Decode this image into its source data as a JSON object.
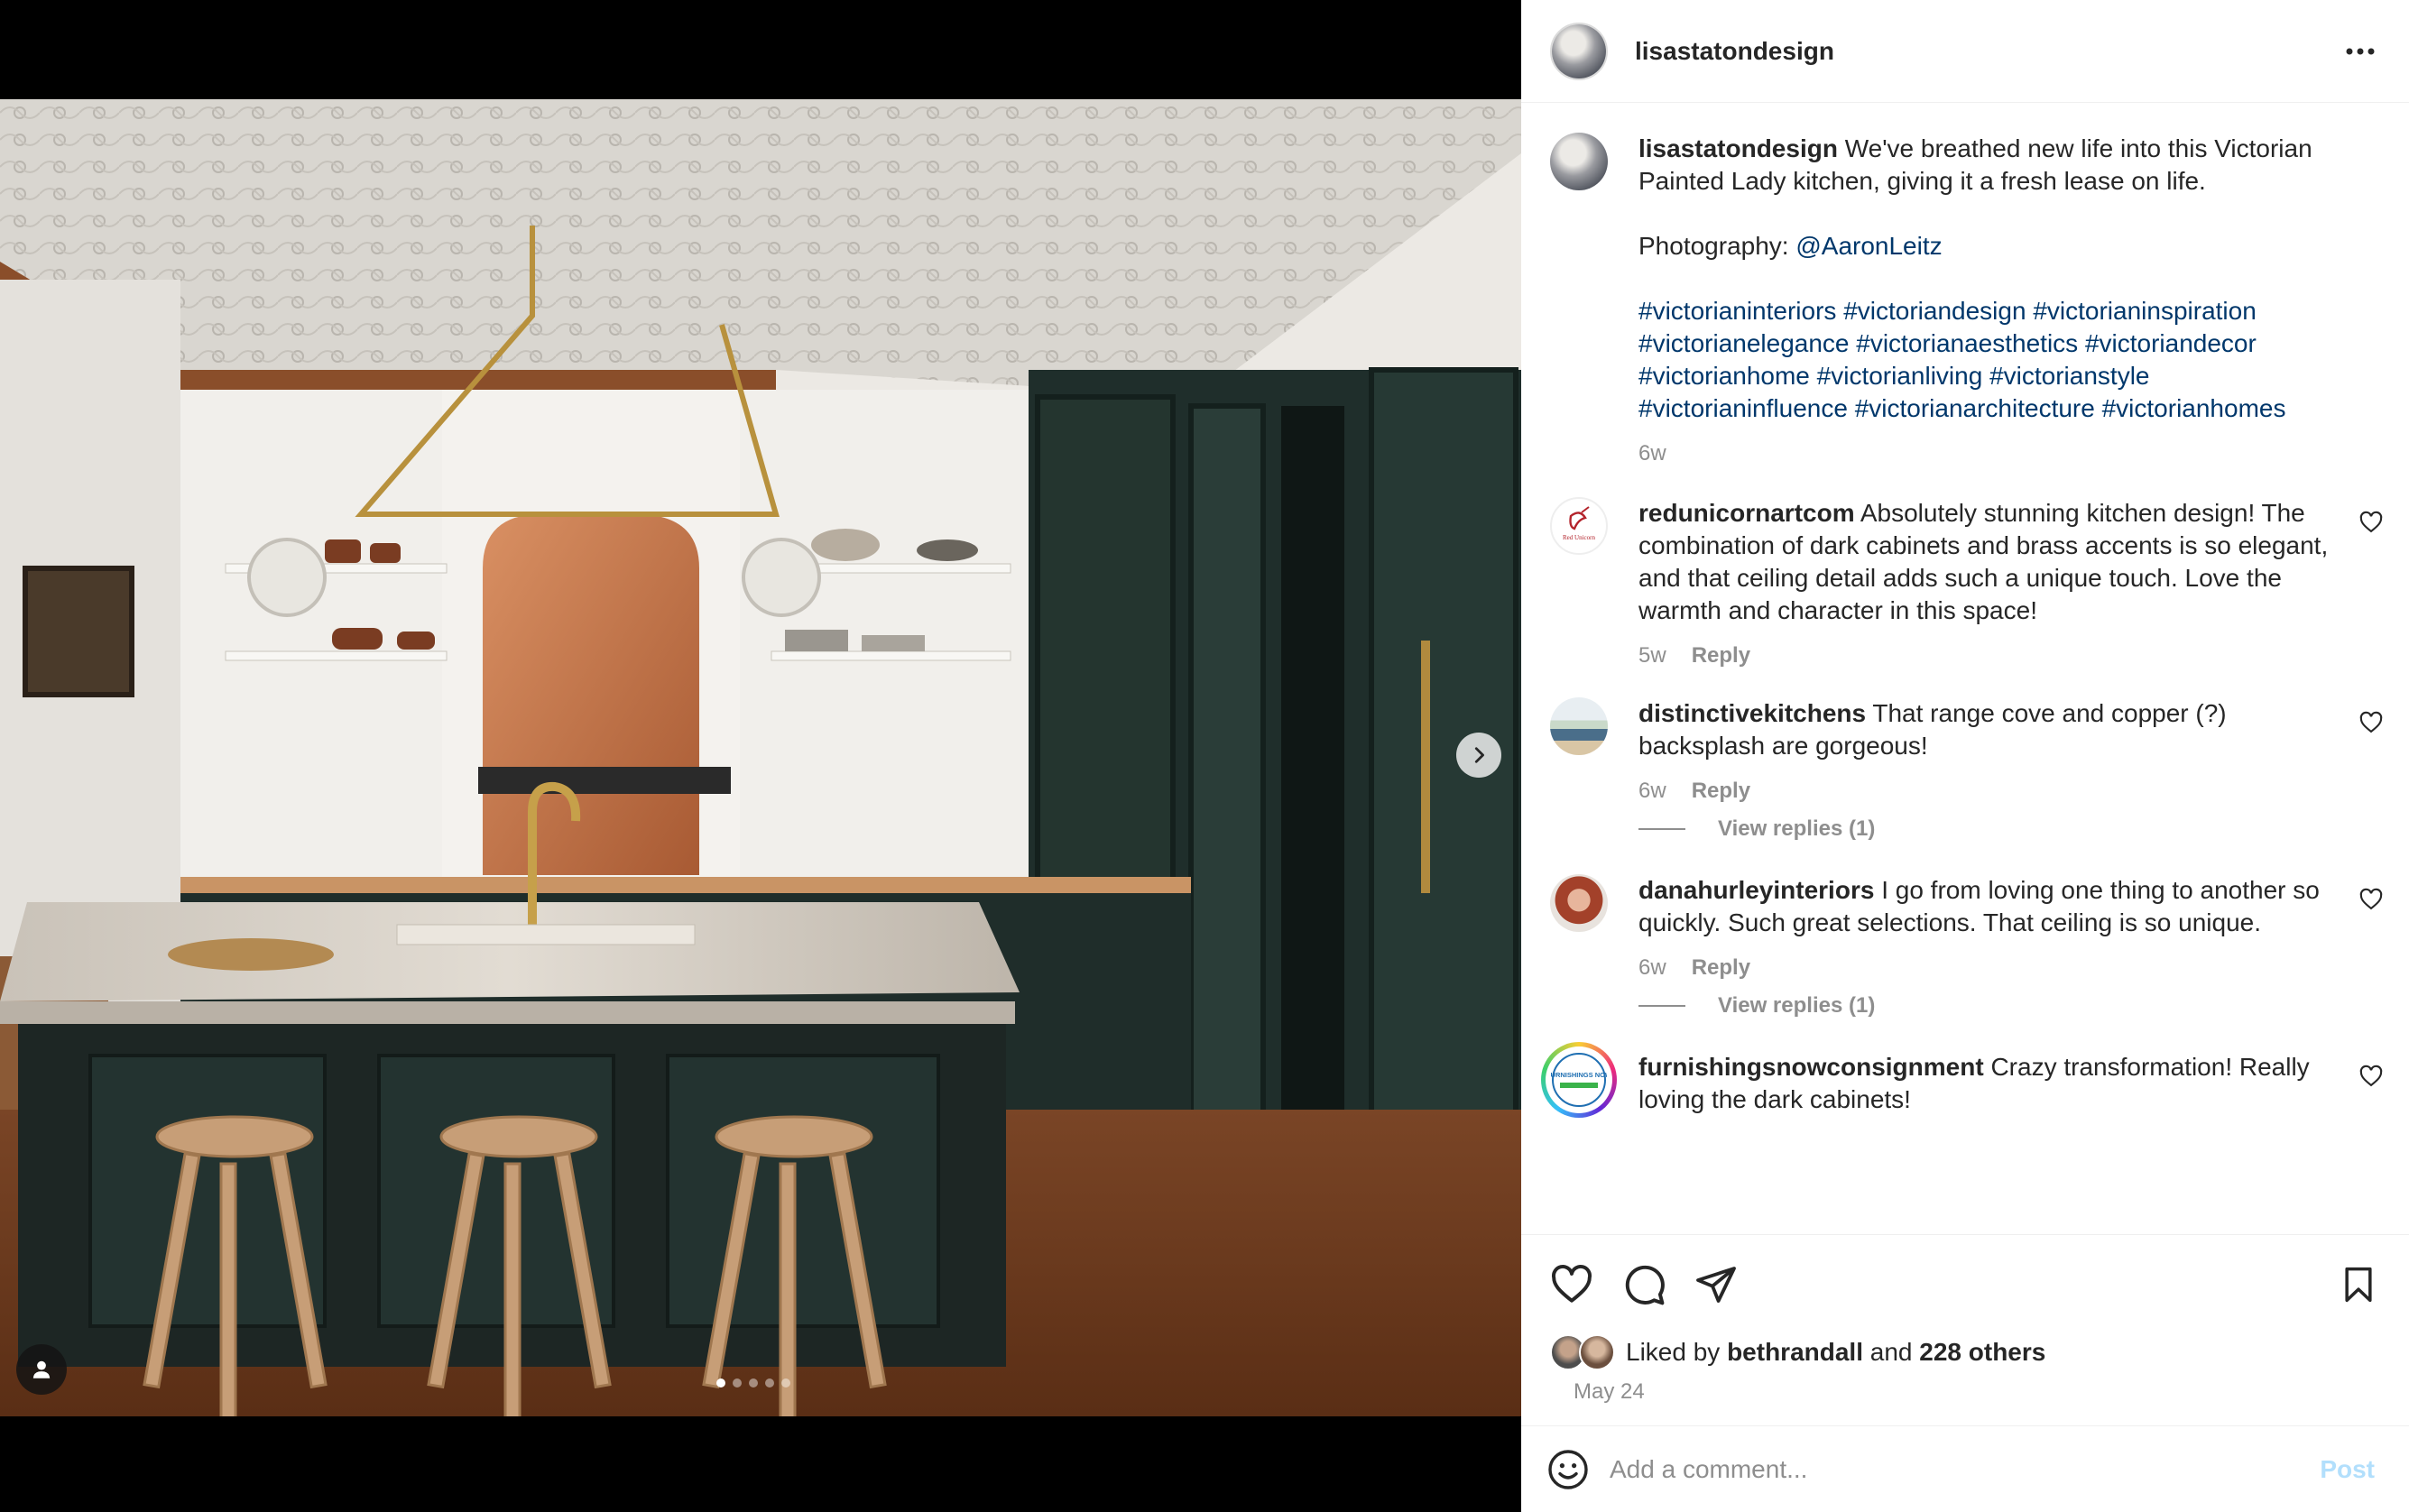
{
  "post": {
    "author": "lisastatondesign",
    "caption": {
      "username": "lisastatondesign",
      "text": "We've breathed new life into this Victorian Painted Lady kitchen, giving it a fresh lease on life.",
      "photography_label": "Photography: ",
      "photography_mention": "@AaronLeitz",
      "hashtags": "#victorianinteriors #victoriandesign #victorianinspiration #victorianelegance #victorianaesthetics #victoriandecor #victorianhome #victorianliving #victorianstyle #victorianinfluence #victorianarchitecture #victorianhomes",
      "time": "6w"
    },
    "carousel": {
      "current": 1,
      "total": 5
    }
  },
  "comments": [
    {
      "username": "redunicornartcom",
      "avatar_text": "Red Unicorn",
      "text": "Absolutely stunning kitchen design! The combination of dark cabinets and brass accents is so elegant, and that ceiling detail adds such a unique touch. Love the warmth and character in this space!",
      "time": "5w",
      "reply_label": "Reply"
    },
    {
      "username": "distinctivekitchens",
      "text": "That range cove and copper (?) backsplash are gorgeous!",
      "time": "6w",
      "reply_label": "Reply",
      "view_replies": "View replies (1)"
    },
    {
      "username": "danahurleyinteriors",
      "text": "I go from loving one thing to another so quickly. Such great selections. That ceiling is so unique.",
      "time": "6w",
      "reply_label": "Reply",
      "view_replies": "View replies (1)"
    },
    {
      "username": "furnishingsnowconsignment",
      "avatar_text": "FURNISHINGS NOW",
      "text": "Crazy transformation! Really loving the dark cabinets!",
      "time": "",
      "reply_label": ""
    }
  ],
  "likes": {
    "prefix": "Liked by",
    "first_liker": "bethrandall",
    "joiner": "and",
    "others": "228 others"
  },
  "date": "May 24",
  "comment_box": {
    "placeholder": "Add a comment...",
    "post_label": "Post"
  },
  "icons": {
    "more": "more-horizontal-icon",
    "like": "heart-icon",
    "comment": "comment-bubble-icon",
    "share": "paper-plane-icon",
    "save": "bookmark-icon",
    "emoji": "smiley-icon",
    "next": "chevron-right-icon",
    "tag": "user-tag-icon"
  },
  "colors": {
    "link": "#00376b",
    "muted": "#8e8e8e",
    "post_disabled": "#b2dffc"
  }
}
